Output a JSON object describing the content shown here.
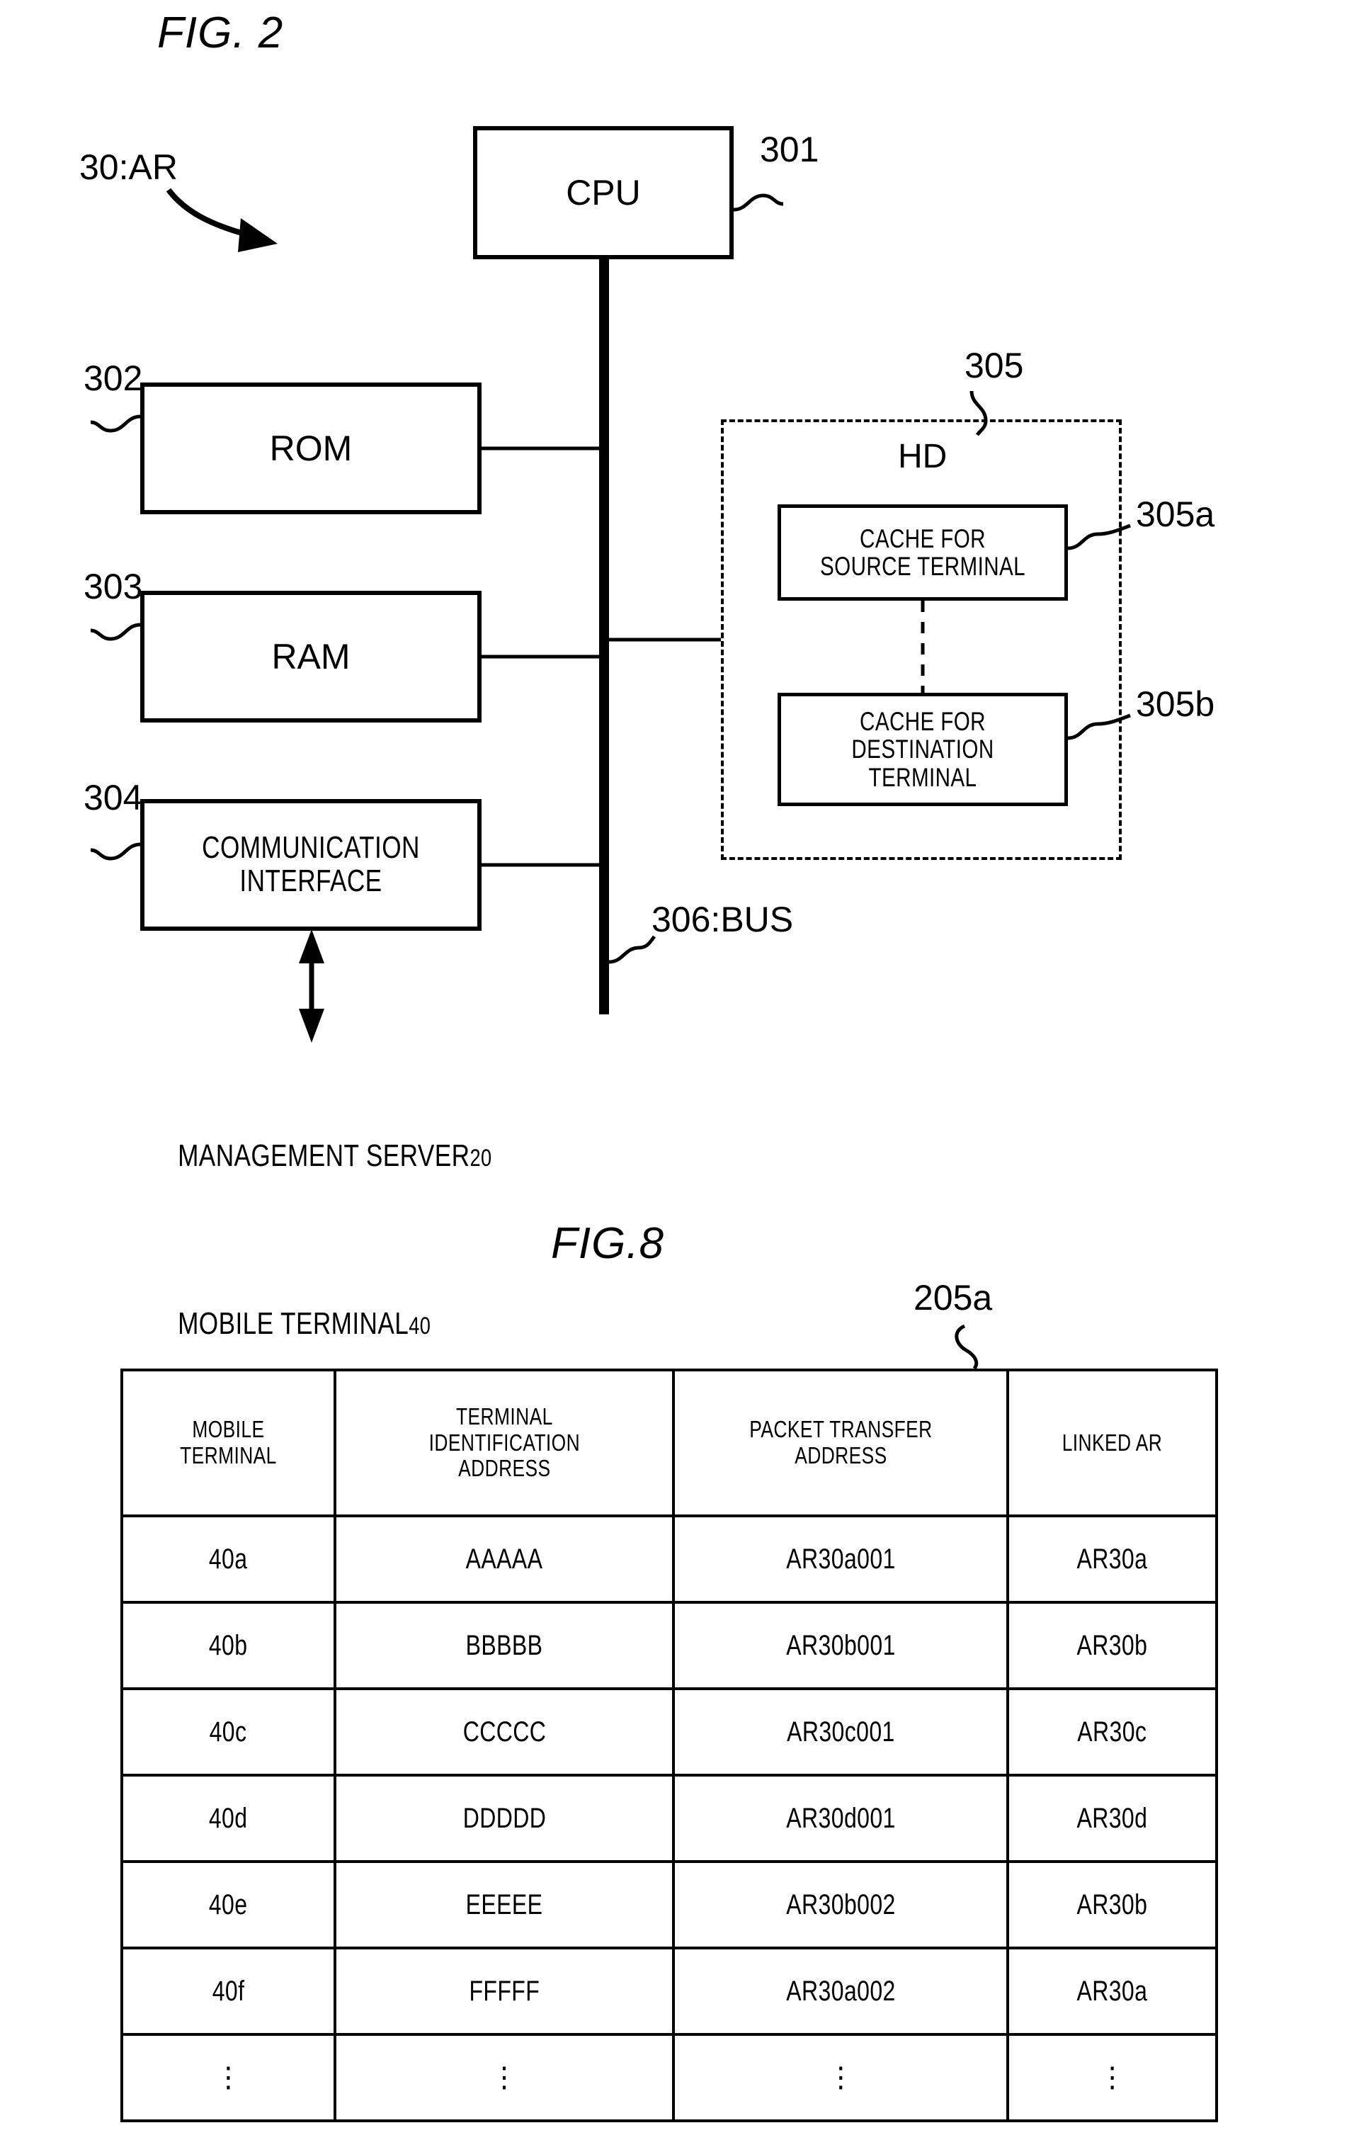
{
  "page": {
    "background_color": "#ffffff",
    "ink_color": "#000000"
  },
  "fig2": {
    "title": "FIG. 2",
    "device_label": "30:AR",
    "blocks": {
      "cpu": {
        "label": "CPU",
        "ref": "301"
      },
      "rom": {
        "label": "ROM",
        "ref": "302"
      },
      "ram": {
        "label": "RAM",
        "ref": "303"
      },
      "comm": {
        "label": "COMMUNICATION\nINTERFACE",
        "ref": "304"
      },
      "hd": {
        "label": "HD",
        "ref": "305"
      },
      "cache_source": {
        "label": "CACHE FOR\nSOURCE TERMINAL",
        "ref": "305a"
      },
      "cache_destination": {
        "label": "CACHE FOR\nDESTINATION\nTERMINAL",
        "ref": "305b"
      },
      "bus": {
        "label": "306:BUS"
      }
    },
    "external": {
      "line1_text": "MANAGEMENT SERVER",
      "line1_num": "20",
      "line2_text": "MOBILE TERMINAL",
      "line2_num": "40"
    }
  },
  "fig8": {
    "title": "FIG.8",
    "table_ref": "205a",
    "table": {
      "headers": [
        "MOBILE\nTERMINAL",
        "TERMINAL\nIDENTIFICATION\nADDRESS",
        "PACKET TRANSFER\nADDRESS",
        "LINKED AR"
      ],
      "rows": [
        [
          "40a",
          "AAAAA",
          "AR30a001",
          "AR30a"
        ],
        [
          "40b",
          "BBBBB",
          "AR30b001",
          "AR30b"
        ],
        [
          "40c",
          "CCCCC",
          "AR30c001",
          "AR30c"
        ],
        [
          "40d",
          "DDDDD",
          "AR30d001",
          "AR30d"
        ],
        [
          "40e",
          "EEEEE",
          "AR30b002",
          "AR30b"
        ],
        [
          "40f",
          "FFFFF",
          "AR30a002",
          "AR30a"
        ],
        [
          "⋮",
          "⋮",
          "⋮",
          "⋮"
        ]
      ]
    }
  }
}
